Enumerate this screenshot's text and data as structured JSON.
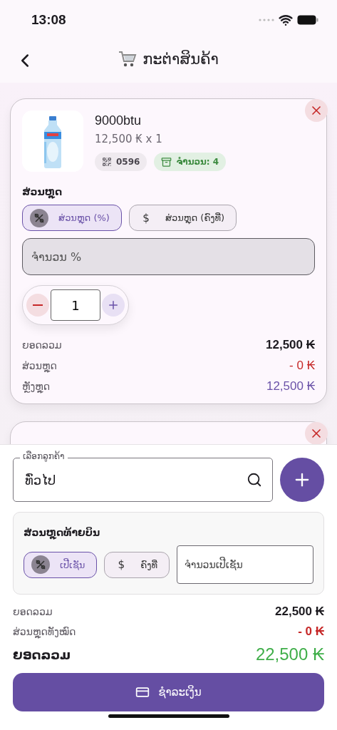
{
  "status_bar": {
    "time": "13:08"
  },
  "header": {
    "title": "ກະຕ່າສິນຄ້າ"
  },
  "cart_items": [
    {
      "name": "9000btu",
      "price_line": "12,500 ₭ x 1",
      "code": "0596",
      "stock": "ຈຳນວນ: 4",
      "discount_label": "ສ່ວນຫຼຸດ",
      "discount_modes": [
        {
          "kind": "percent",
          "label": "ສ່ວນຫຼຸດ (%)",
          "selected": true
        },
        {
          "kind": "fixed",
          "symbol": "$",
          "label": "ສ່ວນຫຼຸດ (ຄົງທີ່)",
          "selected": false
        }
      ],
      "discount_placeholder": "ຈຳນວນ %",
      "quantity": "1",
      "summary": [
        {
          "kind": "plain",
          "label": "ຍອດລວມ",
          "value": "12,500 ₭"
        },
        {
          "kind": "discount",
          "label": "ສ່ວນຫຼຸດ",
          "value": "- 0 ₭"
        },
        {
          "kind": "net",
          "label": "ຫຼັງຫຼຸດ",
          "value": "12,500 ₭"
        }
      ]
    }
  ],
  "customer": {
    "label": "ເລືອກລູກຄ້າ",
    "value": "ທົ່ວໄປ"
  },
  "bill_discount": {
    "title": "ສ່ວນຫຼຸດທ້າຍບິນ",
    "modes": [
      {
        "kind": "percent",
        "label": "ເປີເຊັນ",
        "selected": true
      },
      {
        "kind": "fixed",
        "symbol": "$",
        "label": "ຄົງທີ່",
        "selected": false
      }
    ],
    "placeholder": "ຈຳນວນເປີເຊັນ"
  },
  "totals": [
    {
      "kind": "plain",
      "label": "ຍອດລວມ",
      "value": "22,500 ₭"
    },
    {
      "kind": "discount",
      "label": "ສ່ວນຫຼຸດທັງໝົດ",
      "value": "- 0 ₭"
    },
    {
      "kind": "grand",
      "label": "ຍອດລວມ",
      "value": "22,500 ₭"
    }
  ],
  "pay_button": "ຊຳລະເງິນ"
}
